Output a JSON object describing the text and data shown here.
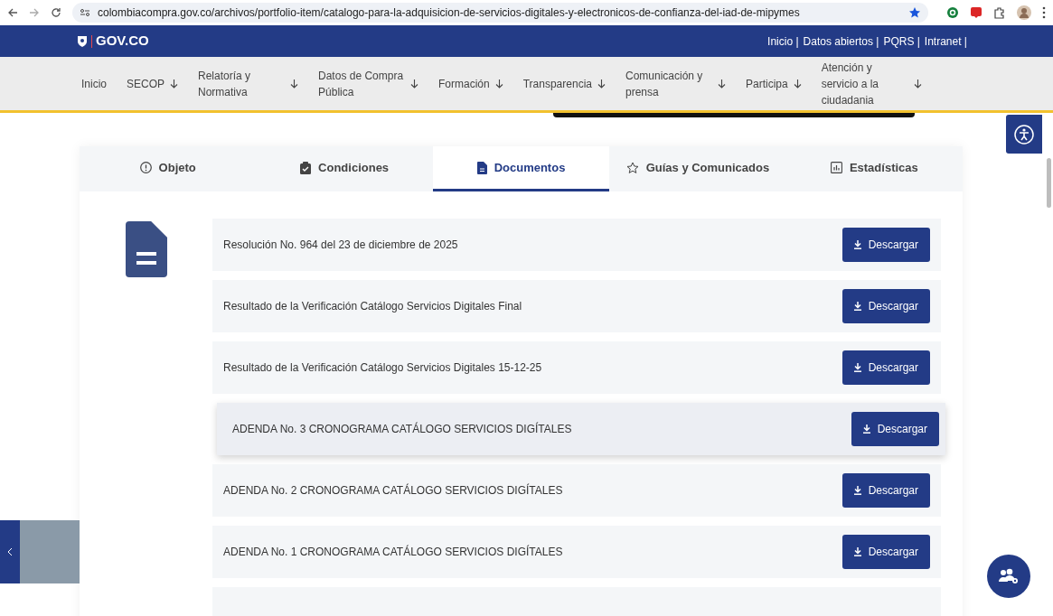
{
  "browser": {
    "url": "colombiacompra.gov.co/archivos/portfolio-item/catalogo-para-la-adquisicion-de-servicios-digitales-y-electronicos-de-confianza-del-iad-de-mipymes"
  },
  "gov_bar": {
    "logo": "GOV.CO",
    "links": [
      "Inicio |",
      "Datos abiertos |",
      "PQRS |",
      "Intranet |"
    ]
  },
  "nav": [
    {
      "label": "Inicio",
      "dropdown": false
    },
    {
      "label": "SECOP",
      "dropdown": true
    },
    {
      "label": "Relatoría y Normativa",
      "dropdown": true
    },
    {
      "label": "Datos de Compra Pública",
      "dropdown": true
    },
    {
      "label": "Formación",
      "dropdown": true
    },
    {
      "label": "Transparencia",
      "dropdown": true
    },
    {
      "label": "Comunicación y prensa",
      "dropdown": true
    },
    {
      "label": "Participa",
      "dropdown": true
    },
    {
      "label": "Atención y servicio a la ciudadania",
      "dropdown": true
    }
  ],
  "tabs": [
    {
      "label": "Objeto",
      "kind": "info",
      "selected": false
    },
    {
      "label": "Condiciones",
      "kind": "clipboard",
      "selected": false
    },
    {
      "label": "Documentos",
      "kind": "document",
      "selected": true
    },
    {
      "label": "Guías y Comunicados",
      "kind": "star",
      "selected": false
    },
    {
      "label": "Estadísticas",
      "kind": "chart",
      "selected": false
    }
  ],
  "documents": [
    {
      "title": "Resolución No. 964 del 23 de diciembre de 2025",
      "button": "Descargar",
      "hovered": false
    },
    {
      "title": "Resultado de la Verificación Catálogo Servicios Digitales Final",
      "button": "Descargar",
      "hovered": false
    },
    {
      "title": "Resultado de la Verificación Catálogo Servicios Digitales 15-12-25",
      "button": "Descargar",
      "hovered": false
    },
    {
      "title": "ADENDA No. 3 CRONOGRAMA CATÁLOGO SERVICIOS DIGÍTALES",
      "button": "Descargar",
      "hovered": true
    },
    {
      "title": "ADENDA No. 2 CRONOGRAMA CATÁLOGO SERVICIOS DIGÍTALES",
      "button": "Descargar",
      "hovered": false
    },
    {
      "title": "ADENDA No. 1 CRONOGRAMA CATÁLOGO SERVICIOS DIGÍTALES",
      "button": "Descargar",
      "hovered": false
    }
  ]
}
